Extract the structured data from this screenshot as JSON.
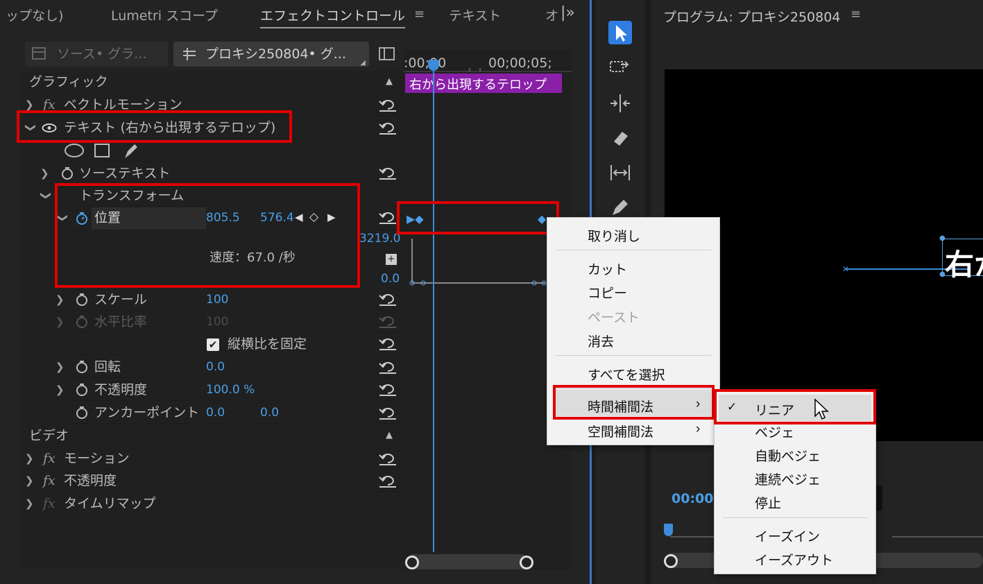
{
  "tabs": [
    {
      "label": "ップなし)"
    },
    {
      "label": "Lumetri スコープ"
    },
    {
      "label": "エフェクトコントロール"
    },
    {
      "label": "テキスト"
    },
    {
      "label": "オ"
    }
  ],
  "source_selector": {
    "source": "ソース• グラ...",
    "sequence": "プロキシ250804• グ..."
  },
  "timeline": {
    "ruler": {
      "start": ":00;00",
      "end": "00;00;05;"
    },
    "clip_label": "右から出現するテロップ",
    "graph_max": "3219.0",
    "graph_min": "0.0"
  },
  "sections": {
    "graphic": "グラフィック",
    "video": "ビデオ"
  },
  "graphic_rows": {
    "vector_motion": "ベクトルモーション",
    "text_layer": "テキスト (右から出現するテロップ)",
    "source_text": "ソーステキスト",
    "transform": "トランスフォーム",
    "position": {
      "label": "位置",
      "x": "805.5",
      "y": "576.4"
    },
    "velocity": "速度：67.0 /秒",
    "scale": {
      "label": "スケール",
      "value": "100"
    },
    "scale_width": {
      "label": "水平比率",
      "value": "100"
    },
    "uniform_scale": {
      "label": "縦横比を固定",
      "checked": true
    },
    "rotation": {
      "label": "回転",
      "value": "0.0"
    },
    "opacity": {
      "label": "不透明度",
      "value": "100.0 %"
    },
    "anchor": {
      "label": "アンカーポイント",
      "x": "0.0",
      "y": "0.0"
    }
  },
  "video_rows": [
    {
      "label": "モーション"
    },
    {
      "label": "不透明度"
    },
    {
      "label": "タイムリマップ"
    }
  ],
  "program": {
    "title": "プログラム: プロキシ250804",
    "preview_text": "右か",
    "timecode": "00:00"
  },
  "context_menu": {
    "items": [
      {
        "label": "取り消し",
        "enabled": true
      },
      {
        "label": "カット",
        "enabled": true
      },
      {
        "label": "コピー",
        "enabled": true
      },
      {
        "label": "ペースト",
        "enabled": false
      },
      {
        "label": "消去",
        "enabled": true
      },
      {
        "label": "すべてを選択",
        "enabled": true
      },
      {
        "label": "時間補間法",
        "enabled": true
      },
      {
        "label": "空間補間法",
        "enabled": true
      }
    ]
  },
  "submenu": {
    "items": [
      {
        "label": "リニア",
        "checked": true
      },
      {
        "label": "ベジェ"
      },
      {
        "label": "自動ベジェ"
      },
      {
        "label": "連続ベジェ"
      },
      {
        "label": "停止"
      },
      {
        "label": "イーズイン"
      },
      {
        "label": "イーズアウト"
      }
    ]
  },
  "colors": {
    "accent": "#4a9ee6",
    "clip": "#8a1fa8",
    "highlight": "#e00000",
    "playhead": "#3d8cd9"
  }
}
